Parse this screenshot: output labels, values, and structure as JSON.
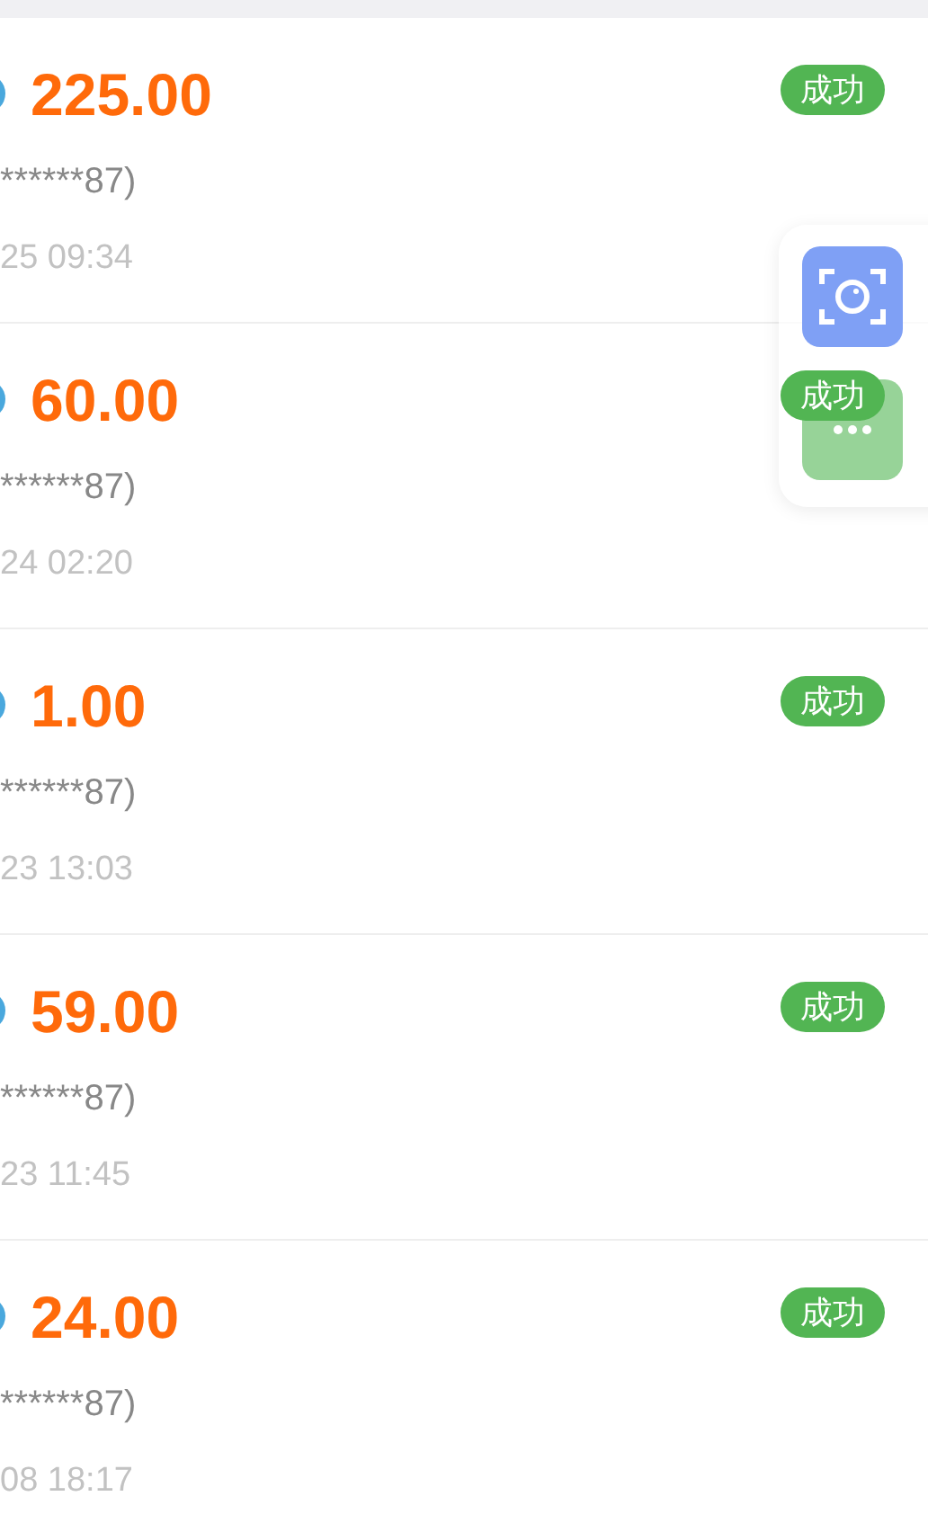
{
  "records": [
    {
      "amount": "225.00",
      "account": "******87)",
      "time": "25 09:34",
      "status": "成功"
    },
    {
      "amount": "60.00",
      "account": "******87)",
      "time": "24 02:20",
      "status": "成功"
    },
    {
      "amount": "1.00",
      "account": "******87)",
      "time": "23 13:03",
      "status": "成功"
    },
    {
      "amount": "59.00",
      "account": "******87)",
      "time": "23 11:45",
      "status": "成功"
    },
    {
      "amount": "24.00",
      "account": "******87)",
      "time": "08 18:17",
      "status": "成功"
    }
  ]
}
